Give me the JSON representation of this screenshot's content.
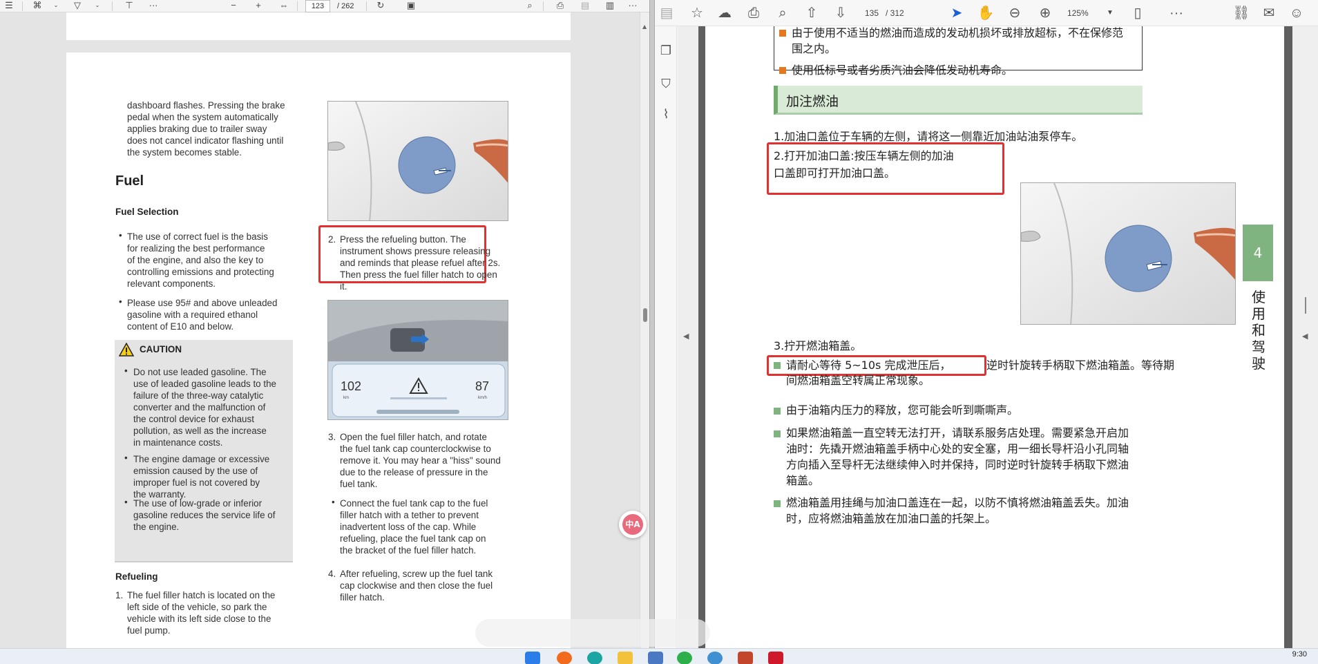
{
  "left_viewer": {
    "toolbar": {
      "menu_icon": "list-icon",
      "page_current": "123",
      "page_total": "/ 262",
      "zoom_minus": "−",
      "zoom_plus": "+",
      "more": "···"
    },
    "page": {
      "col1": {
        "intro_lines": [
          "dashboard flashes. Pressing the brake",
          "pedal when the system automatically",
          "applies braking due to trailer sway",
          "does not cancel indicator flashing until",
          "the system becomes stable."
        ],
        "fuel_heading": "Fuel",
        "fuel_selection_heading": "Fuel Selection",
        "bullet1_lines": [
          "The use of correct fuel is the basis",
          "for realizing the best performance",
          "of the engine, and also the key to",
          "controlling emissions and protecting",
          "relevant components."
        ],
        "bullet2_lines": [
          "Please use 95# and above unleaded",
          "gasoline with a required ethanol",
          "content of E10 and below."
        ],
        "caution": {
          "title": "CAUTION",
          "item1_lines": [
            "Do not use leaded gasoline. The",
            "use of leaded gasoline leads to the",
            "failure of the three-way catalytic",
            "converter and the malfunction of",
            "the control device for exhaust",
            "pollution, as well as the increase",
            "in maintenance costs."
          ],
          "item2_lines": [
            "The engine damage or excessive",
            "emission caused by the use of",
            "improper fuel is not covered by",
            "the warranty."
          ],
          "item3_lines": [
            "The use of low-grade or inferior",
            "gasoline reduces the service life of",
            "the engine."
          ]
        },
        "refueling_heading": "Refueling",
        "refuel_item1_num": "1.",
        "refuel_item1_lines": [
          "The fuel filler hatch is located on the",
          "left side of the vehicle, so park the",
          "vehicle with its left side close to the",
          "fuel pump."
        ]
      },
      "col2": {
        "step2_num": "2.",
        "step2_lines": [
          "Press the refueling button. The",
          "instrument shows pressure releasing",
          "and reminds that please refuel after 2s.",
          "Then press the fuel filler hatch to open",
          "it."
        ],
        "cluster_left": "102",
        "cluster_left_unit": "km",
        "cluster_right": "87",
        "cluster_right_unit": "km/h",
        "step3_num": "3.",
        "step3_lines": [
          "Open the fuel filler hatch, and rotate",
          "the fuel tank cap counterclockwise to",
          "remove it. You may hear a \"hiss\" sound",
          "due to the release of pressure in the",
          "fuel tank."
        ],
        "step3_bullet_lines": [
          "Connect the fuel tank cap to the fuel",
          "filler hatch with a tether to prevent",
          "inadvertent loss of the cap. While",
          "refueling, place the fuel tank cap on",
          "the bracket of the fuel filler hatch."
        ],
        "step4_num": "4.",
        "step4_lines": [
          "After refueling, screw up the fuel tank",
          "cap clockwise and then close the fuel",
          "filler hatch."
        ]
      }
    },
    "floating_badge": "中A"
  },
  "right_viewer": {
    "toolbar": {
      "page_current": "135",
      "page_total": "/ 312",
      "zoom": "125%"
    },
    "page": {
      "warn_line1": "由于使用不适当的燃油而造成的发动机损坏或排放超标，不在保修范",
      "warn_line1b": "围之内。",
      "warn_line2": "使用低标号或者劣质汽油会降低发动机寿命。",
      "section_title": "加注燃油",
      "step1": "1.加油口盖位于车辆的左侧，请将这一侧靠近加油站油泵停车。",
      "step2_line1": "2.打开加油口盖:按压车辆左侧的加油",
      "step2_line2": "口盖即可打开加油口盖。",
      "step3": "3.拧开燃油箱盖。",
      "b1_line1_a": "请耐心等待 5~10s 完成泄压后，",
      "b1_line1_b": "逆时针旋转手柄取下燃油箱盖。等待期",
      "b1_line2": "间燃油箱盖空转属正常现象。",
      "b2": "由于油箱内压力的释放，您可能会听到嘶嘶声。",
      "b3_line1": "如果燃油箱盖一直空转无法打开，请联系服务店处理。需要紧急开启加",
      "b3_line2": "油时：先撬开燃油箱盖手柄中心处的安全塞，用一细长导杆沿小孔同轴",
      "b3_line3": "方向插入至导杆无法继续伸入时并保持，同时逆时针旋转手柄取下燃油",
      "b3_line4": "箱盖。",
      "b4_line1": "燃油箱盖用挂绳与加油口盖连在一起，以防不慎将燃油箱盖丢失。加油",
      "b4_line2": "时，应将燃油箱盖放在加油口盖的托架上。"
    },
    "chapter_number": "4",
    "chapter_title": "使用和驾驶"
  },
  "taskbar": {
    "clock": "9:30"
  },
  "colors": {
    "highlight_red": "#e0302f",
    "section_green": "#7fb37f",
    "bullet_orange": "#e5781c",
    "fuel_door_blue": "#7f9cc8"
  }
}
